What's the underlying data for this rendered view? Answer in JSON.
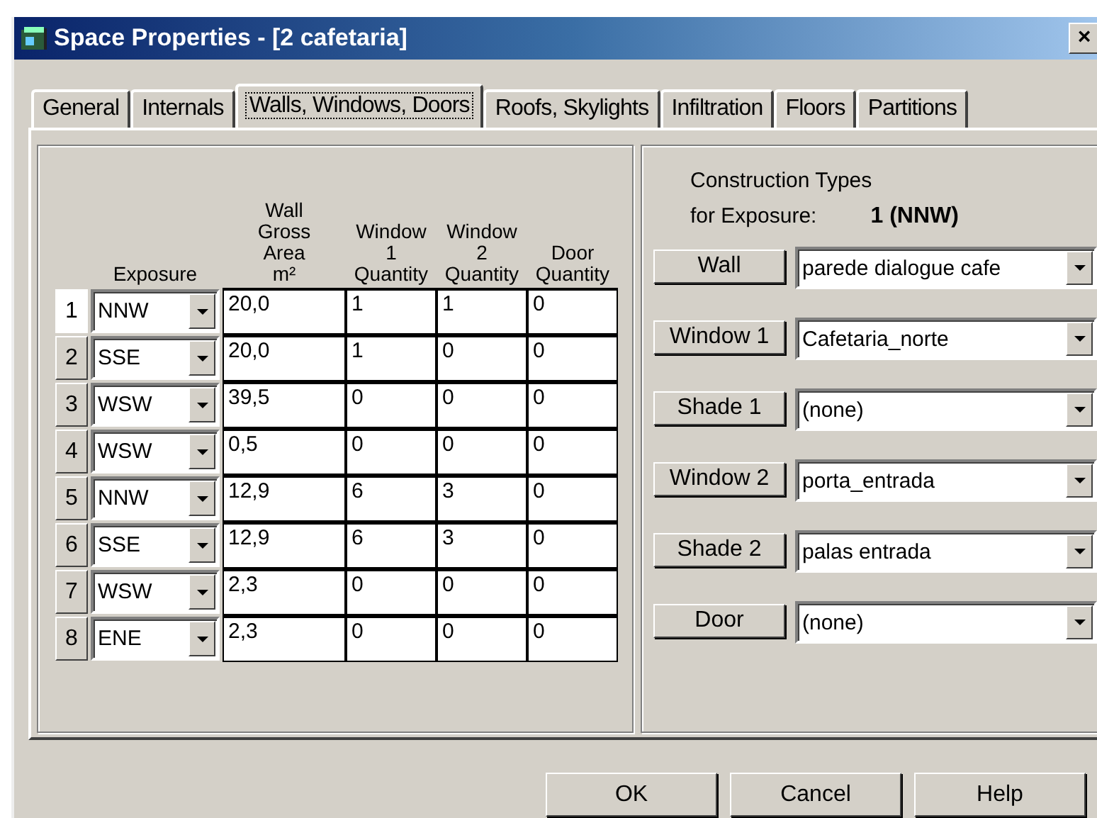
{
  "window": {
    "title": "Space Properties - [2 cafetaria]",
    "close": "×"
  },
  "tabs": [
    {
      "label": "General",
      "selected": false
    },
    {
      "label": "Internals",
      "selected": false
    },
    {
      "label": "Walls, Windows, Doors",
      "selected": true
    },
    {
      "label": "Roofs, Skylights",
      "selected": false
    },
    {
      "label": "Infiltration",
      "selected": false
    },
    {
      "label": "Floors",
      "selected": false
    },
    {
      "label": "Partitions",
      "selected": false
    }
  ],
  "table": {
    "columns": [
      "Exposure",
      "Wall\nGross\nArea\nm²",
      "Window\n1\nQuantity",
      "Window\n2\nQuantity",
      "Door\nQuantity"
    ],
    "rows": [
      {
        "number": "1",
        "selected": true,
        "cells": [
          "NNW",
          "20,0",
          "1",
          "1",
          "0"
        ]
      },
      {
        "number": "2",
        "selected": false,
        "cells": [
          "SSE",
          "20,0",
          "1",
          "0",
          "0"
        ]
      },
      {
        "number": "3",
        "selected": false,
        "cells": [
          "WSW",
          "39,5",
          "0",
          "0",
          "0"
        ]
      },
      {
        "number": "4",
        "selected": false,
        "cells": [
          "WSW",
          "0,5",
          "0",
          "0",
          "0"
        ]
      },
      {
        "number": "5",
        "selected": false,
        "cells": [
          "NNW",
          "12,9",
          "6",
          "3",
          "0"
        ]
      },
      {
        "number": "6",
        "selected": false,
        "cells": [
          "SSE",
          "12,9",
          "6",
          "3",
          "0"
        ]
      },
      {
        "number": "7",
        "selected": false,
        "cells": [
          "WSW",
          "2,3",
          "0",
          "0",
          "0"
        ]
      },
      {
        "number": "8",
        "selected": false,
        "cells": [
          "ENE",
          "2,3",
          "0",
          "0",
          "0"
        ]
      }
    ]
  },
  "construction": {
    "heading": "Construction Types",
    "exposure_label": "for Exposure:",
    "exposure_value": "1 (NNW)",
    "items": [
      {
        "button": "Wall",
        "value": "parede dialogue cafe"
      },
      {
        "button": "Window 1",
        "value": "Cafetaria_norte"
      },
      {
        "button": "Shade 1",
        "value": "(none)"
      },
      {
        "button": "Window 2",
        "value": "porta_entrada"
      },
      {
        "button": "Shade 2",
        "value": "palas entrada"
      },
      {
        "button": "Door",
        "value": "(none)"
      }
    ]
  },
  "buttons": [
    "OK",
    "Cancel",
    "Help"
  ]
}
